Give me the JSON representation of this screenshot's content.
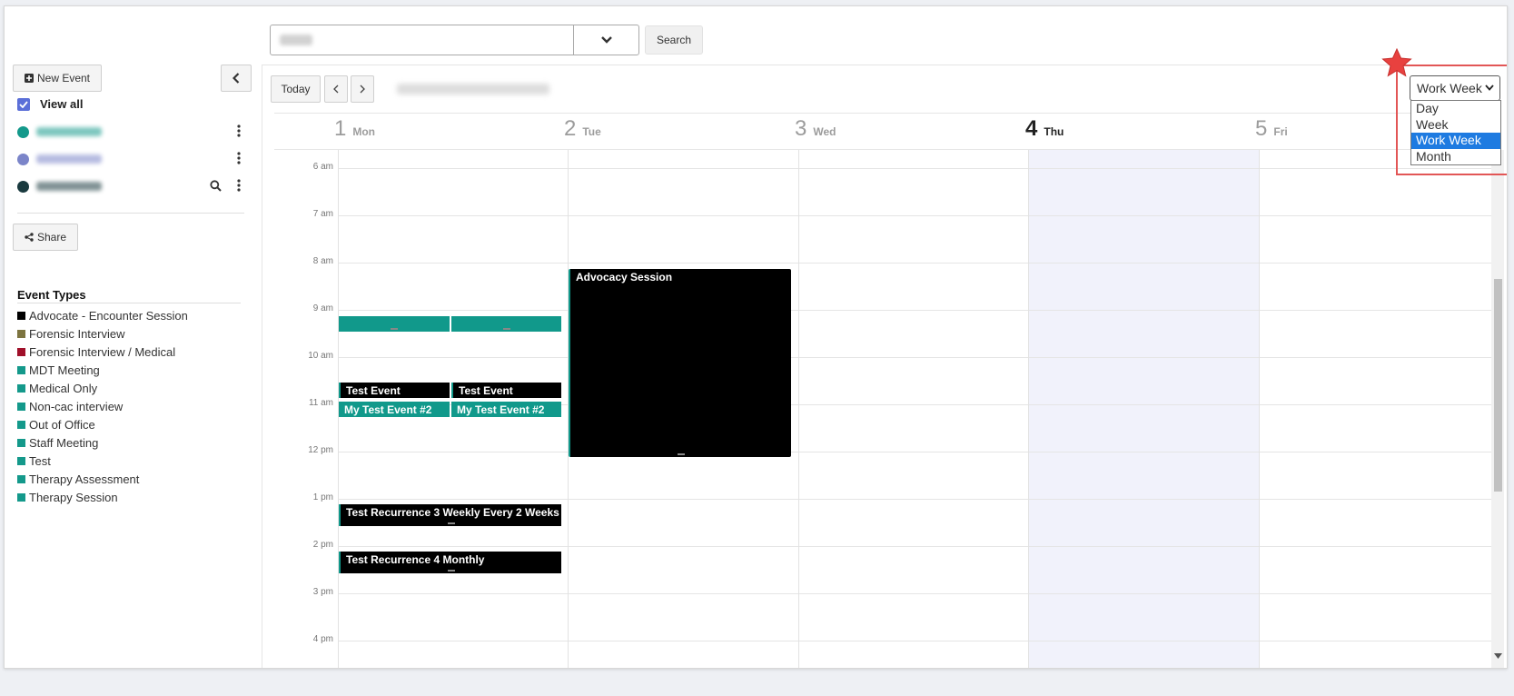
{
  "search": {
    "value": "",
    "button_label": "Search"
  },
  "sidebar": {
    "new_event_label": "New Event",
    "view_all_label": "View all",
    "calendars": [
      {
        "color": "#14998b"
      },
      {
        "color": "#7b85c9"
      },
      {
        "color": "#1a3a3f"
      }
    ],
    "share_label": "Share",
    "event_types_title": "Event Types",
    "event_types": [
      {
        "label": "Advocate - Encounter Session",
        "color": "#000000"
      },
      {
        "label": "Forensic Interview",
        "color": "#7d7440"
      },
      {
        "label": "Forensic Interview / Medical",
        "color": "#a0102a"
      },
      {
        "label": "MDT Meeting",
        "color": "#14998b"
      },
      {
        "label": "Medical Only",
        "color": "#14998b"
      },
      {
        "label": "Non-cac interview",
        "color": "#14998b"
      },
      {
        "label": "Out of Office",
        "color": "#14998b"
      },
      {
        "label": "Staff Meeting",
        "color": "#14998b"
      },
      {
        "label": "Test",
        "color": "#14998b"
      },
      {
        "label": "Therapy Assessment",
        "color": "#14998b"
      },
      {
        "label": "Therapy Session",
        "color": "#14998b"
      }
    ]
  },
  "toolbar": {
    "today_label": "Today",
    "view_select": {
      "value": "Work Week",
      "options": [
        "Day",
        "Week",
        "Work Week",
        "Month"
      ],
      "selected_index": 2
    }
  },
  "days": [
    {
      "num": "1",
      "name": "Mon"
    },
    {
      "num": "2",
      "name": "Tue"
    },
    {
      "num": "3",
      "name": "Wed"
    },
    {
      "num": "4",
      "name": "Thu",
      "today": true
    },
    {
      "num": "5",
      "name": "Fri"
    }
  ],
  "times": [
    "6 am",
    "7 am",
    "8 am",
    "9 am",
    "10 am",
    "11 am",
    "12 pm",
    "1 pm",
    "2 pm",
    "3 pm",
    "4 pm"
  ],
  "events": [
    {
      "title": "",
      "style": "teal"
    },
    {
      "title": "",
      "style": "teal"
    },
    {
      "title": "Test Event",
      "style": "black"
    },
    {
      "title": "Test Event",
      "style": "black"
    },
    {
      "title": "My Test Event #2",
      "style": "teal"
    },
    {
      "title": "My Test Event #2",
      "style": "teal"
    },
    {
      "title": "Advocacy Session",
      "style": "black"
    },
    {
      "title": "Test Recurrence 3 Weekly Every 2 Weeks",
      "style": "black"
    },
    {
      "title": "Test Recurrence 4 Monthly",
      "style": "black"
    }
  ],
  "colors": {
    "teal": "#11998b",
    "accent": "#1e7be1",
    "highlight": "#e25656",
    "star": "#e8413f"
  }
}
